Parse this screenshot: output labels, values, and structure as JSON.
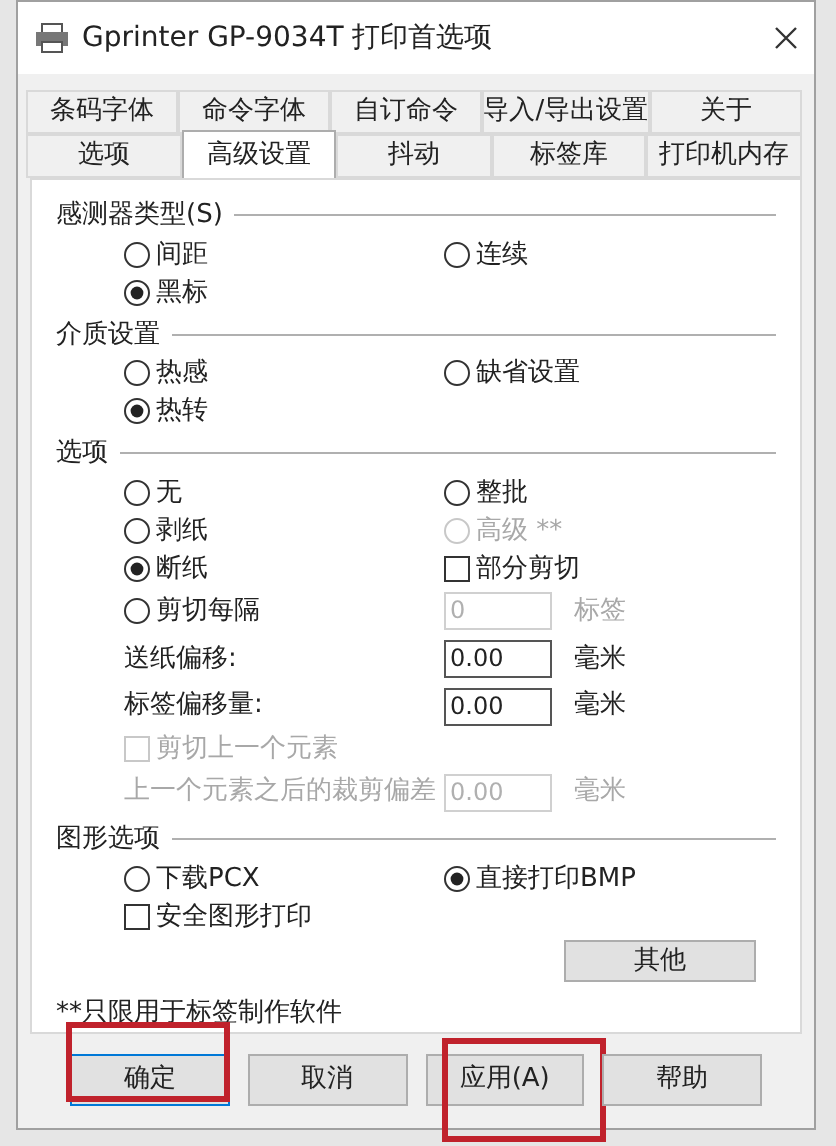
{
  "window": {
    "title": "Gprinter  GP-9034T 打印首选项"
  },
  "tab_rows": [
    [
      {
        "label": "条码字体",
        "selected": false
      },
      {
        "label": "命令字体",
        "selected": false
      },
      {
        "label": "自订命令",
        "selected": false
      },
      {
        "label": "导入/导出设置",
        "selected": false
      },
      {
        "label": "关于",
        "selected": false
      }
    ],
    [
      {
        "label": "选项",
        "selected": false
      },
      {
        "label": "高级设置",
        "selected": true
      },
      {
        "label": "抖动",
        "selected": false
      },
      {
        "label": "标签库",
        "selected": false
      },
      {
        "label": "打印机内存",
        "selected": false
      }
    ]
  ],
  "sections": [
    {
      "title": "感测器类型(S)",
      "rows": [
        [
          {
            "kind": "radio",
            "label": "间距",
            "selected": false
          },
          {
            "kind": "radio",
            "label": "连续",
            "selected": false
          }
        ],
        [
          {
            "kind": "radio",
            "label": "黑标",
            "selected": true
          }
        ]
      ]
    },
    {
      "title": "介质设置",
      "rows": [
        [
          {
            "kind": "radio",
            "label": "热感",
            "selected": false
          },
          {
            "kind": "radio",
            "label": "缺省设置",
            "selected": false
          }
        ],
        [
          {
            "kind": "radio",
            "label": "热转",
            "selected": true
          }
        ]
      ]
    },
    {
      "title": "选项",
      "rows": [
        [
          {
            "kind": "radio",
            "label": "无",
            "selected": false
          },
          {
            "kind": "radio",
            "label": "整批",
            "selected": false
          }
        ],
        [
          {
            "kind": "radio",
            "label": "剥纸",
            "selected": false
          },
          {
            "kind": "radio",
            "label": "高级 **",
            "selected": false,
            "disabled": true
          }
        ],
        [
          {
            "kind": "radio",
            "label": "断纸",
            "selected": true
          },
          {
            "kind": "checkbox",
            "label": "部分剪切",
            "checked": false
          }
        ],
        [
          {
            "kind": "radio",
            "label": "剪切每隔",
            "selected": false
          },
          {
            "kind": "field",
            "value": "0",
            "unit": "标签",
            "disabled": true
          }
        ],
        [
          {
            "kind": "label",
            "label": "送纸偏移:"
          },
          {
            "kind": "field",
            "value": "0.00",
            "unit": "毫米",
            "disabled": false
          }
        ],
        [
          {
            "kind": "label",
            "label": "标签偏移量:"
          },
          {
            "kind": "field",
            "value": "0.00",
            "unit": "毫米",
            "disabled": false
          }
        ],
        [
          {
            "kind": "checkbox",
            "label": "剪切上一个元素",
            "checked": false,
            "disabled": true
          }
        ],
        [
          {
            "kind": "label",
            "label": "上一个元素之后的裁剪偏差",
            "disabled": true
          },
          {
            "kind": "field",
            "value": "0.00",
            "unit": "毫米",
            "disabled": true
          }
        ]
      ]
    },
    {
      "title": "图形选项",
      "rows": [
        [
          {
            "kind": "radio",
            "label": "下载PCX",
            "selected": false
          },
          {
            "kind": "radio",
            "label": "直接打印BMP",
            "selected": true
          }
        ],
        [
          {
            "kind": "checkbox",
            "label": "安全图形打印",
            "checked": false
          }
        ]
      ]
    }
  ],
  "other_button": "其他",
  "footnote": "**只限用于标签制作软件",
  "buttons": [
    {
      "label": "确定",
      "highlighted": true
    },
    {
      "label": "取消",
      "highlighted": false
    },
    {
      "label": "应用(A)",
      "highlighted": true
    },
    {
      "label": "帮助",
      "highlighted": false
    }
  ]
}
